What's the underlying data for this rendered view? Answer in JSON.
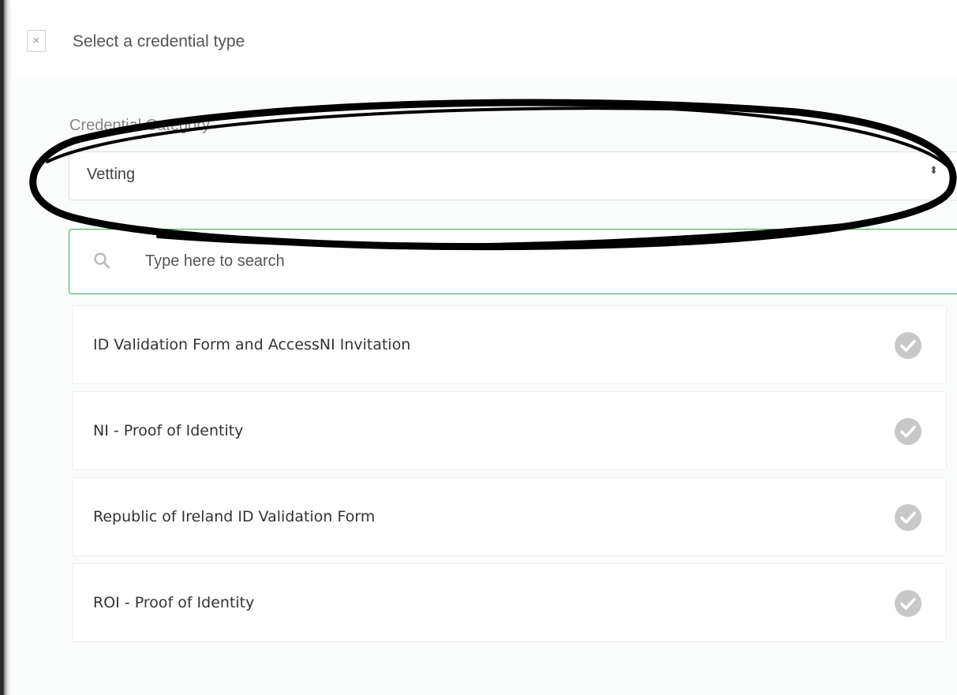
{
  "header": {
    "close_glyph": "×",
    "title": "Select a credential type"
  },
  "form": {
    "category_label": "Credential Category",
    "category_value": "Vetting",
    "category_caret": "⬍",
    "search_placeholder": "Type here to search"
  },
  "credentials": [
    {
      "label": "ID Validation Form and AccessNI Invitation",
      "icon": "check-circle-icon"
    },
    {
      "label": "NI - Proof of Identity",
      "icon": "check-circle-icon"
    },
    {
      "label": "Republic of Ireland ID Validation Form",
      "icon": "check-circle-icon"
    },
    {
      "label": "ROI - Proof of Identity",
      "icon": "check-circle-icon"
    }
  ],
  "colors": {
    "accent_green": "#3aaa5a",
    "check_grey": "#c8c8c8",
    "annotation": "#000000"
  }
}
